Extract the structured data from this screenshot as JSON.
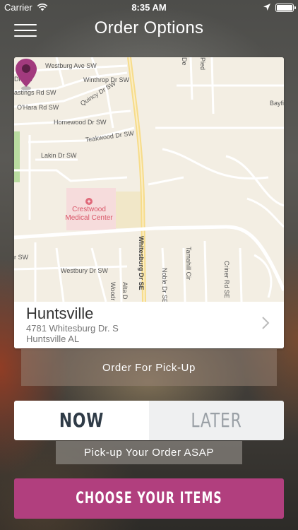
{
  "status_bar": {
    "carrier": "Carrier",
    "time": "8:35 AM",
    "icons": [
      "wifi-icon",
      "location-arrow-icon",
      "battery-icon"
    ]
  },
  "nav": {
    "title": "Order Options",
    "menu_icon": "hamburger-menu-icon"
  },
  "map": {
    "streets": [
      "Westburg Ave SW",
      "Dr SW",
      "Winthrop Dr SW",
      "astings Rd SW",
      "Quincy Dr SW",
      "O'Hara Rd SW",
      "Bayfi",
      "Homewood Dr SW",
      "Teakwood Dr SW",
      "Lakin Dr SW",
      "Westbury Dr SW",
      "Whitesburg Dr SE",
      "Noble Dr SE",
      "Tamahill Cir",
      "Criner Rd SE",
      "Woodr",
      "Alta D",
      "De",
      "Pied",
      "r SW"
    ],
    "poi": {
      "name_line1": "Crestwood",
      "name_line2": "Medical Center",
      "icon": "hospital-cross-icon"
    },
    "pin_icon": "map-pin-icon"
  },
  "location": {
    "city": "Huntsville",
    "address": "4781 Whitesburg Dr. S",
    "city_state": "Huntsville AL"
  },
  "order_type_label": "Order For Pick-Up",
  "timing": {
    "now_label": "NOW",
    "later_label": "LATER",
    "selected": "NOW"
  },
  "asap_label": "Pick-up Your Order ASAP",
  "cta_label": "CHOOSE YOUR ITEMS",
  "colors": {
    "accent": "#b13f7e",
    "pin": "#a23a7e",
    "hospital": "#d95668",
    "now_text": "#2f3b47",
    "later_text": "#9aa0a6"
  }
}
